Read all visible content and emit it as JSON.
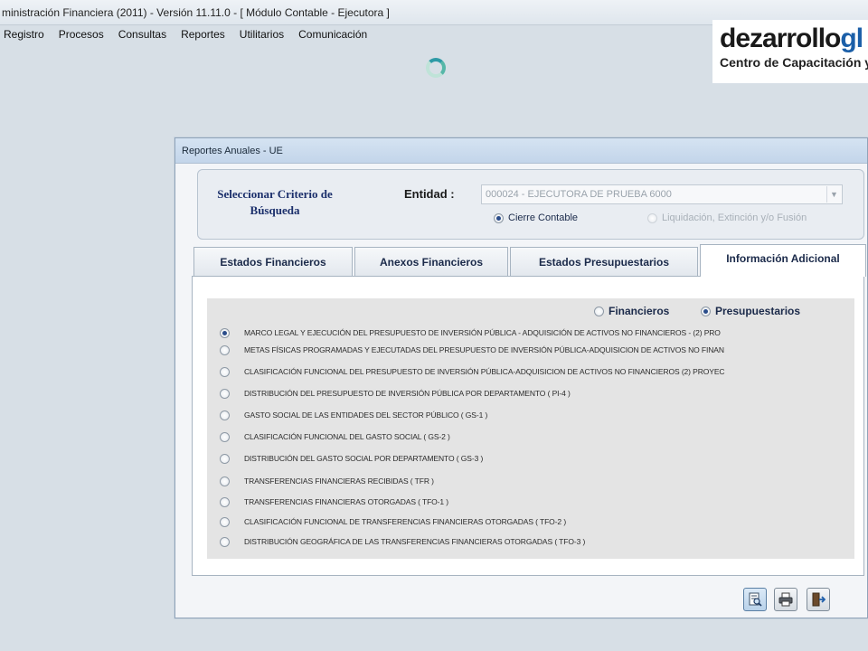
{
  "app": {
    "title": "ministración Financiera (2011) - Versión 11.11.0 - [ Módulo Contable - Ejecutora ]",
    "menu": [
      "Registro",
      "Procesos",
      "Consultas",
      "Reportes",
      "Utilitarios",
      "Comunicación"
    ]
  },
  "watermark": {
    "name_part1": "dezarrollo",
    "name_part2": "gl",
    "subtitle": "Centro de Capacitación y"
  },
  "dialog": {
    "title": "Reportes Anuales - UE",
    "criteria_title": "Seleccionar Criterio de Búsqueda",
    "entity_label": "Entidad :",
    "entity_value": "000024 - EJECUTORA DE PRUEBA 6000",
    "option_cierre": "Cierre Contable",
    "option_liquidacion": "Liquidación, Extinción y/o Fusión",
    "tabs": [
      {
        "label": "Estados Financieros",
        "active": false
      },
      {
        "label": "Anexos Financieros",
        "active": false
      },
      {
        "label": "Estados Presupuestarios",
        "active": false
      },
      {
        "label": "Información Adicional",
        "active": true
      }
    ],
    "type_financieros": "Financieros",
    "type_presupuestarios": "Presupuestarios",
    "reports": [
      {
        "label": "MARCO LEGAL Y EJECUCIÓN DEL PRESUPUESTO DE INVERSIÓN PÚBLICA - ADQUISICIÓN DE ACTIVOS NO FINANCIEROS - (2) PRO",
        "selected": true
      },
      {
        "label": "METAS FÍSICAS PROGRAMADAS Y EJECUTADAS DEL PRESUPUESTO DE INVERSIÓN PÚBLICA-ADQUISICION DE ACTIVOS NO FINAN",
        "selected": false
      },
      {
        "label": "CLASIFICACIÓN FUNCIONAL DEL PRESUPUESTO DE INVERSIÓN PÚBLICA-ADQUISICION DE ACTIVOS NO FINANCIEROS (2) PROYEC",
        "selected": false
      },
      {
        "label": "DISTRIBUCIÓN DEL PRESUPUESTO DE INVERSIÓN PÚBLICA POR DEPARTAMENTO ( PI-4 )",
        "selected": false
      },
      {
        "label": "GASTO SOCIAL DE LAS ENTIDADES DEL SECTOR PÚBLICO ( GS-1 )",
        "selected": false
      },
      {
        "label": "CLASIFICACIÓN FUNCIONAL DEL GASTO SOCIAL ( GS-2 )",
        "selected": false
      },
      {
        "label": "DISTRIBUCIÓN DEL GASTO SOCIAL POR DEPARTAMENTO ( GS-3 )",
        "selected": false
      },
      {
        "label": "TRANSFERENCIAS FINANCIERAS RECIBIDAS ( TFR )",
        "selected": false
      },
      {
        "label": "TRANSFERENCIAS FINANCIERAS OTORGADAS ( TFO-1 )",
        "selected": false
      },
      {
        "label": "CLASIFICACIÓN FUNCIONAL DE TRANSFERENCIAS FINANCIERAS OTORGADAS ( TFO-2 )",
        "selected": false
      },
      {
        "label": "DISTRIBUCIÓN GEOGRÁFICA DE LAS TRANSFERENCIAS FINANCIERAS OTORGADAS ( TFO-3 )",
        "selected": false
      }
    ]
  }
}
